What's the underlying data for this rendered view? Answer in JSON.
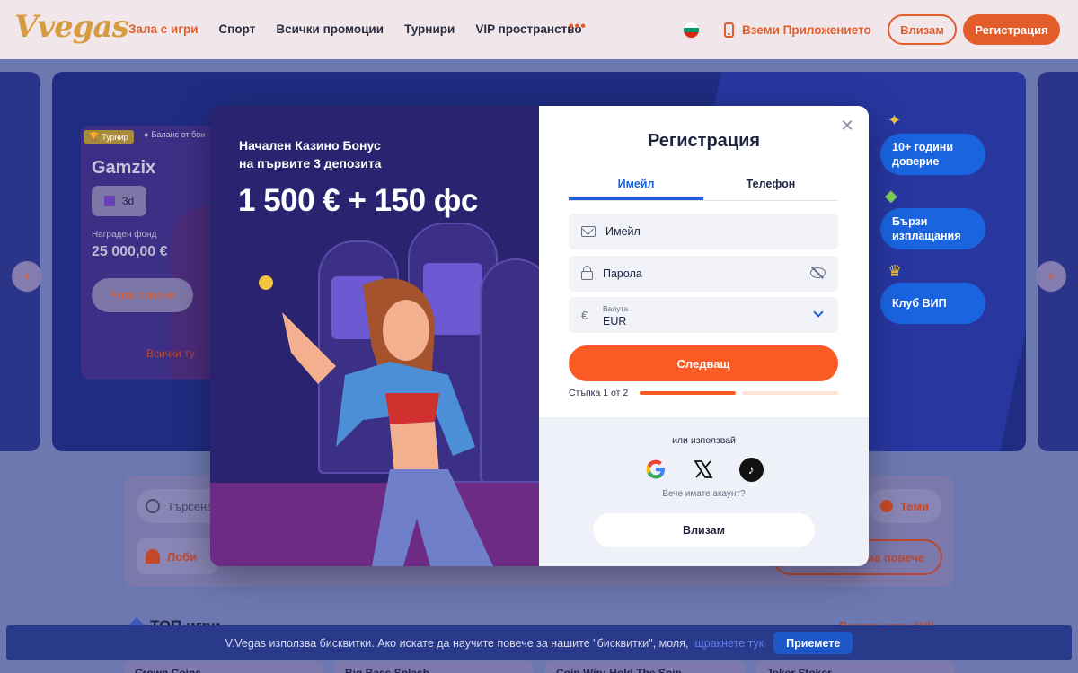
{
  "header": {
    "logo": "Vvegas",
    "nav": [
      "Зала с игри",
      "Спорт",
      "Всички промоции",
      "Турнири",
      "VIP пространство"
    ],
    "more": "•••",
    "app_link": "Вземи Приложението",
    "login": "Влизам",
    "register": "Регистрация",
    "flag_colors": [
      "#ffffff",
      "#00966e",
      "#d62612"
    ]
  },
  "background": {
    "tournament": {
      "badge": "Турнир",
      "balance_badge": "Баланс от бон",
      "title": "Gamzix",
      "timer": "3d",
      "prize_label": "Награден фонд",
      "prize": "25 000,00 €",
      "more": "Чети повече",
      "all_tournaments": "Всички ту"
    },
    "perks": [
      "10+ години доверие",
      "Бързи изплащания",
      "Клуб ВИП"
    ],
    "search_placeholder": "Търсене",
    "lobby": "Лоби",
    "themes": "Теми",
    "more_outline": "на повече",
    "top_games": "ТОП игри",
    "see_all": "Всички игри (10)",
    "games": [
      "Crown Coins",
      "Big Bass Splash",
      "Coin Win: Hold The Spin",
      "Joker Stoker"
    ]
  },
  "modal": {
    "promo_line1": "Начален Казино Бонус",
    "promo_line2": "на първите 3 депозита",
    "promo_amount": "1 500 € + 150 фс",
    "title": "Регистрация",
    "tabs": [
      "Имейл",
      "Телефон"
    ],
    "email_placeholder": "Имейл",
    "password_placeholder": "Парола",
    "currency_label": "Валута",
    "currency_value": "EUR",
    "currency_symbol": "€",
    "next": "Следващ",
    "step": "Стъпка 1 от 2",
    "step_progress": 0.5,
    "or_use": "или използвай",
    "social": [
      "google-icon",
      "x-icon",
      "tiktok-icon"
    ],
    "have_account": "Вече имате акаунт?",
    "login": "Влизам"
  },
  "cookie": {
    "text": "V.Vegas използва бисквитки. Ако искате да научите повече за нашите \"бисквитки\", моля,",
    "link": "щракнете тук",
    "accept": "Приемете"
  },
  "colors": {
    "accent": "#e35d2b",
    "primary_blue": "#1a5fd6",
    "next_button": "#fa5a23"
  }
}
